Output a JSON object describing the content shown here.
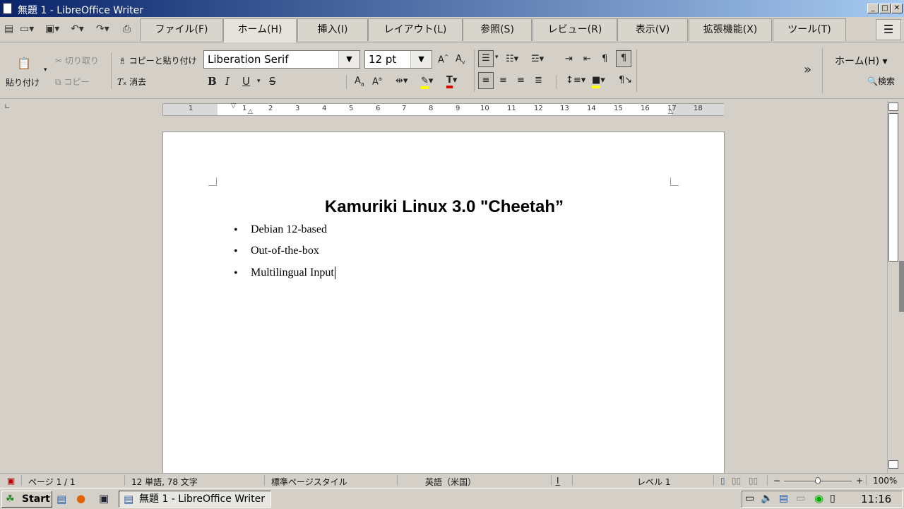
{
  "window": {
    "title": "無題 1 - LibreOffice Writer"
  },
  "tabs": [
    {
      "label": "ファイル(F)",
      "active": false
    },
    {
      "label": "ホーム(H)",
      "active": true
    },
    {
      "label": "挿入(I)",
      "active": false
    },
    {
      "label": "レイアウト(L)",
      "active": false
    },
    {
      "label": "参照(S)",
      "active": false
    },
    {
      "label": "レビュー(R)",
      "active": false
    },
    {
      "label": "表示(V)",
      "active": false
    },
    {
      "label": "拡張機能(X)",
      "active": false
    },
    {
      "label": "ツール(T)",
      "active": false
    }
  ],
  "ribbon": {
    "paste": "貼り付け",
    "cut": "切り取り",
    "copy": "コピー",
    "clone": "コピーと貼り付け",
    "clear": "消去",
    "font_name": "Liberation Serif",
    "font_size": "12 pt",
    "context": "ホーム(H)",
    "search": "検索"
  },
  "ruler": {
    "numbers": [
      "1",
      "1",
      "2",
      "3",
      "4",
      "5",
      "6",
      "7",
      "8",
      "9",
      "10",
      "11",
      "12",
      "13",
      "14",
      "15",
      "16",
      "17",
      "18"
    ]
  },
  "document": {
    "title": "Kamuriki Linux 3.0 \"Cheetah”",
    "bullets": [
      "Debian 12-based",
      "Out-of-the-box",
      "Multilingual Input"
    ]
  },
  "status": {
    "page": "ページ 1 / 1",
    "words": "12 単語, 78 文字",
    "style": "標準ページスタイル",
    "language": "英語（米国）",
    "level": "レベル 1",
    "zoom": "100%"
  },
  "taskbar": {
    "start": "Start",
    "task": "無題 1 - LibreOffice Writer",
    "clock": "11:16"
  },
  "colors": {
    "highlight": "#ffff00",
    "font_color": "#e00000",
    "titlebar": "#0a246a"
  }
}
